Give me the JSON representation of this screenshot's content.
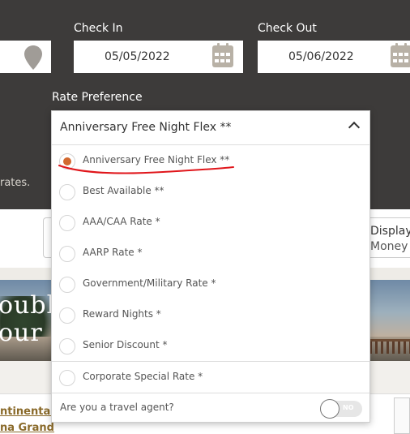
{
  "search": {
    "check_in_label": "Check In",
    "check_in_value": "05/05/2022",
    "check_out_label": "Check Out",
    "check_out_value": "05/06/2022",
    "rate_label": "Rate Preference",
    "rates_note_tail": "rates."
  },
  "rate_dropdown": {
    "selected": "Anniversary Free Night Flex **",
    "options": [
      {
        "label": "Anniversary Free Night Flex **",
        "selected": true
      },
      {
        "label": "Best Available **",
        "selected": false
      },
      {
        "label": "AAA/CAA Rate *",
        "selected": false
      },
      {
        "label": "AARP Rate *",
        "selected": false
      },
      {
        "label": "Government/Military Rate *",
        "selected": false
      },
      {
        "label": "Reward Nights *",
        "selected": false
      },
      {
        "label": "Senior Discount *",
        "selected": false
      },
      {
        "label": "Corporate Special Rate *",
        "selected": false
      }
    ],
    "travel_agent_label": "Are you a travel agent?",
    "travel_agent_toggle": "NO"
  },
  "display": {
    "line1": "Display Prices",
    "line2": "Money"
  },
  "hero_image": {
    "line1": "ouble",
    "line2": "our"
  },
  "hotel_link": {
    "line1": "ntinental",
    "line2": "na Grand"
  },
  "colors": {
    "header_bg": "#3d3b3a",
    "radio_selected": "#d2692f",
    "annotation": "#e0161b",
    "link": "#8a6a2a"
  }
}
